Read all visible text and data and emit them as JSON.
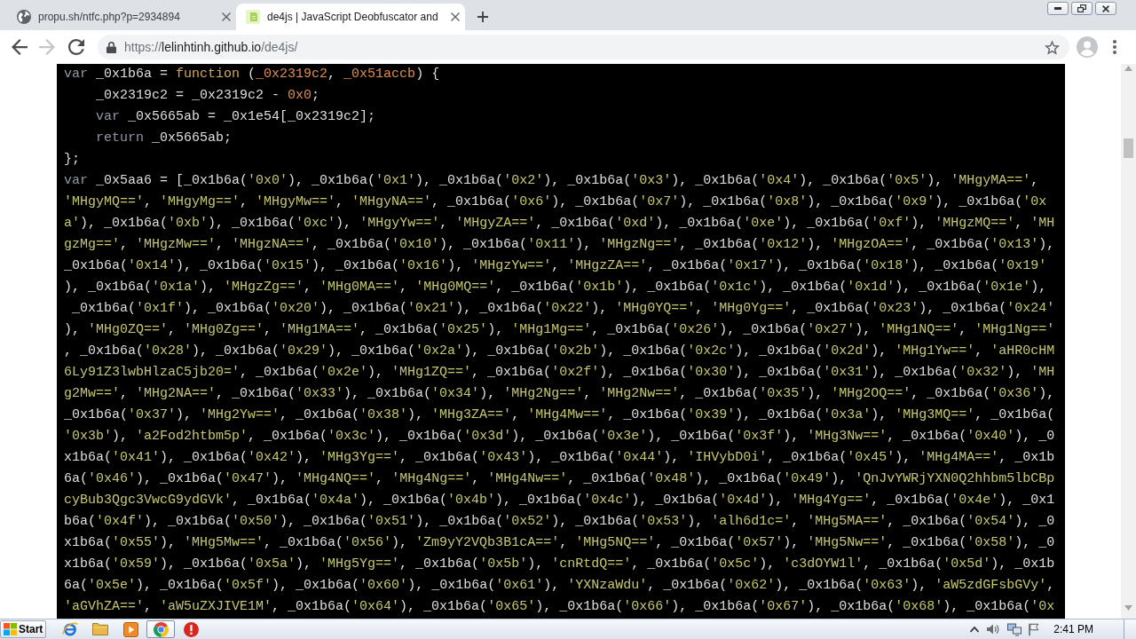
{
  "tabs": [
    {
      "title": "propu.sh/ntfc.php?p=2934894",
      "selected": false
    },
    {
      "title": "de4js | JavaScript Deobfuscator and",
      "selected": true
    }
  ],
  "nav_buttons": [
    {
      "kind": "back",
      "disabled": false
    },
    {
      "kind": "forward",
      "disabled": true
    },
    {
      "kind": "reload",
      "disabled": false
    }
  ],
  "address_bar": {
    "scheme": "https://",
    "host": "lelinhtinh.github.io",
    "path": "/de4js/"
  },
  "code_lines": [
    {
      "segments": [
        {
          "kind": "keyword",
          "text": "var"
        },
        {
          "kind": "plain",
          "text": " _0x1b6a = "
        },
        {
          "kind": "declaration",
          "text": "function"
        },
        {
          "kind": "plain",
          "text": " ("
        },
        {
          "kind": "param",
          "text": "_0x2319c2"
        },
        {
          "kind": "plain",
          "text": ", "
        },
        {
          "kind": "param",
          "text": "_0x51accb"
        },
        {
          "kind": "plain",
          "text": ") {"
        }
      ],
      "children": [
        {
          "segments": [
            {
              "kind": "plain",
              "text": "_0x2319c2 = _0x2319c2 - "
            },
            {
              "kind": "number",
              "text": "0x0"
            },
            {
              "kind": "plain",
              "text": ";"
            }
          ]
        },
        {
          "segments": [
            {
              "kind": "keyword",
              "text": "var"
            },
            {
              "kind": "plain",
              "text": " _0x5665ab = _0x1e54[_0x2319c2];"
            }
          ]
        },
        {
          "segments": [
            {
              "kind": "keyword",
              "text": "return"
            },
            {
              "kind": "plain",
              "text": " _0x5665ab;"
            }
          ]
        }
      ]
    },
    {
      "segments": [
        {
          "kind": "plain",
          "text": "};"
        }
      ]
    },
    {
      "segments": [
        {
          "kind": "keyword",
          "text": "var"
        },
        {
          "kind": "code",
          "text": " _0x5aa6 = [_0x1b6a('0x0'), _0x1b6a('0x1'), _0x1b6a('0x2'), _0x1b6a('0x3'), _0x1b6a('0x4'), _0x1b6a('0x5'), 'MHgyMA==',"
        }
      ]
    },
    {
      "segments": [
        {
          "kind": "code",
          "text": "'MHgyMQ==', 'MHgyMg==', 'MHgyMw==', 'MHgyNA==', _0x1b6a('0x6'), _0x1b6a('0x7'), _0x1b6a('0x8'), _0x1b6a('0x9'), _0x1b6a('0x"
        }
      ]
    },
    {
      "segments": [
        {
          "kind": "code",
          "text": "a'), _0x1b6a('0xb'), _0x1b6a('0xc'), 'MHgyYw==', 'MHgyZA==', _0x1b6a('0xd'), _0x1b6a('0xe'), _0x1b6a('0xf'), 'MHgzMQ==', 'MH"
        }
      ]
    },
    {
      "segments": [
        {
          "kind": "code",
          "text": "gzMg==', 'MHgzMw==', 'MHgzNA==', _0x1b6a('0x10'), _0x1b6a('0x11'), 'MHgzNg==', _0x1b6a('0x12'), 'MHgzOA==', _0x1b6a('0x13'),"
        }
      ]
    },
    {
      "segments": [
        {
          "kind": "code",
          "text": "_0x1b6a('0x14'), _0x1b6a('0x15'), _0x1b6a('0x16'), 'MHgzYw==', 'MHgzZA==', _0x1b6a('0x17'), _0x1b6a('0x18'), _0x1b6a('0x19'"
        }
      ]
    },
    {
      "segments": [
        {
          "kind": "code",
          "text": "), _0x1b6a('0x1a'), 'MHgzZg==', 'MHg0MA==', 'MHg0MQ==', _0x1b6a('0x1b'), _0x1b6a('0x1c'), _0x1b6a('0x1d'), _0x1b6a('0x1e'),"
        }
      ]
    },
    {
      "segments": [
        {
          "kind": "code",
          "text": " _0x1b6a('0x1f'), _0x1b6a('0x20'), _0x1b6a('0x21'), _0x1b6a('0x22'), 'MHg0YQ==', 'MHg0Yg==', _0x1b6a('0x23'), _0x1b6a('0x24'"
        }
      ]
    },
    {
      "segments": [
        {
          "kind": "code",
          "text": "), 'MHg0ZQ==', 'MHg0Zg==', 'MHg1MA==', _0x1b6a('0x25'), 'MHg1Mg==', _0x1b6a('0x26'), _0x1b6a('0x27'), 'MHg1NQ==', 'MHg1Ng=='"
        }
      ]
    },
    {
      "segments": [
        {
          "kind": "code",
          "text": ", _0x1b6a('0x28'), _0x1b6a('0x29'), _0x1b6a('0x2a'), _0x1b6a('0x2b'), _0x1b6a('0x2c'), _0x1b6a('0x2d'), 'MHg1Yw==', 'aHR0cHM"
        }
      ]
    },
    {
      "segments": [
        {
          "kind": "code",
          "text": "6Ly91Z3lwbHlzaC5jb20=', _0x1b6a('0x2e'), 'MHg1ZQ==', _0x1b6a('0x2f'), _0x1b6a('0x30'), _0x1b6a('0x31'), _0x1b6a('0x32'), 'MH"
        }
      ]
    },
    {
      "segments": [
        {
          "kind": "code",
          "text": "g2Mw==', 'MHg2NA==', _0x1b6a('0x33'), _0x1b6a('0x34'), 'MHg2Ng==', 'MHg2Nw==', _0x1b6a('0x35'), 'MHg2OQ==', _0x1b6a('0x36'),"
        }
      ]
    },
    {
      "segments": [
        {
          "kind": "code",
          "text": "_0x1b6a('0x37'), 'MHg2Yw==', _0x1b6a('0x38'), 'MHg3ZA==', 'MHg4Mw==', _0x1b6a('0x39'), _0x1b6a('0x3a'), 'MHg3MQ==', _0x1b6a("
        }
      ]
    },
    {
      "segments": [
        {
          "kind": "code",
          "text": "'0x3b'), 'a2Fod2htbm5p', _0x1b6a('0x3c'), _0x1b6a('0x3d'), _0x1b6a('0x3e'), _0x1b6a('0x3f'), 'MHg3Nw==', _0x1b6a('0x40'), _0"
        }
      ]
    },
    {
      "segments": [
        {
          "kind": "code",
          "text": "x1b6a('0x41'), _0x1b6a('0x42'), 'MHg3Yg==', _0x1b6a('0x43'), _0x1b6a('0x44'), 'IHVybD0i', _0x1b6a('0x45'), 'MHg4MA==', _0x1b"
        }
      ]
    },
    {
      "segments": [
        {
          "kind": "code",
          "text": "6a('0x46'), _0x1b6a('0x47'), 'MHg4NQ==', 'MHg4Ng==', 'MHg4Nw==', _0x1b6a('0x48'), _0x1b6a('0x49'), 'QnJvYWRjYXN0Q2hhbm5lbCBp"
        }
      ]
    },
    {
      "segments": [
        {
          "kind": "code",
          "text": "cyBub3Qgc3VwcG9ydGVk', _0x1b6a('0x4a'), _0x1b6a('0x4b'), _0x1b6a('0x4c'), _0x1b6a('0x4d'), 'MHg4Yg==', _0x1b6a('0x4e'), _0x1"
        }
      ]
    },
    {
      "segments": [
        {
          "kind": "code",
          "text": "b6a('0x4f'), _0x1b6a('0x50'), _0x1b6a('0x51'), _0x1b6a('0x52'), _0x1b6a('0x53'), 'alh6d1c=', 'MHg5MA==', _0x1b6a('0x54'), _0"
        }
      ]
    },
    {
      "segments": [
        {
          "kind": "code",
          "text": "x1b6a('0x55'), 'MHg5Mw==', _0x1b6a('0x56'), 'Zm9yY2VQb3B1cA==', 'MHg5NQ==', _0x1b6a('0x57'), 'MHg5Nw==', _0x1b6a('0x58'), _0"
        }
      ]
    },
    {
      "segments": [
        {
          "kind": "code",
          "text": "x1b6a('0x59'), _0x1b6a('0x5a'), 'MHg5Yg==', _0x1b6a('0x5b'), 'cnRtdQ==', _0x1b6a('0x5c'), 'c3dOYW1l', _0x1b6a('0x5d'), _0x1b"
        }
      ]
    },
    {
      "segments": [
        {
          "kind": "code",
          "text": "6a('0x5e'), _0x1b6a('0x5f'), _0x1b6a('0x60'), _0x1b6a('0x61'), 'YXNzaWdu', _0x1b6a('0x62'), _0x1b6a('0x63'), 'aW5zdGFsbGVy',"
        }
      ]
    },
    {
      "segments": [
        {
          "kind": "code",
          "text": "'aGVhZA==', 'aW5uZXJIVE1M', _0x1b6a('0x64'), _0x1b6a('0x65'), _0x1b6a('0x66'), _0x1b6a('0x67'), _0x1b6a('0x68'), _0x1b6a('0x"
        }
      ]
    }
  ],
  "taskbar": {
    "start_label": "Start",
    "apps": [
      {
        "kind": "e_browser",
        "selected": false
      },
      {
        "kind": "folder",
        "selected": false
      },
      {
        "kind": "player",
        "selected": false
      },
      {
        "kind": "browser",
        "selected": true
      },
      {
        "kind": "alert",
        "selected": false
      }
    ],
    "clock": "2:41 PM"
  }
}
